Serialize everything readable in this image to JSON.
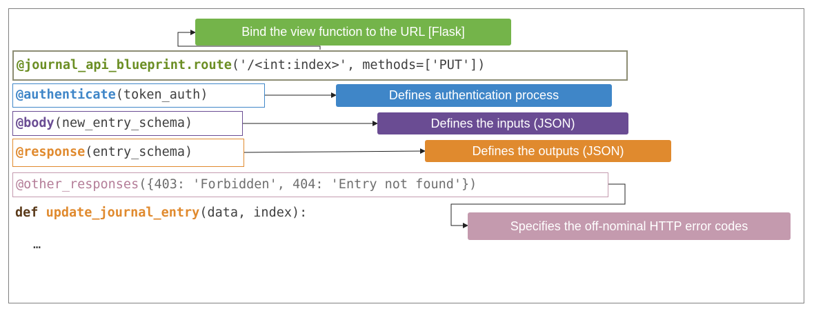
{
  "callouts": {
    "route": "Bind the view function to the URL [Flask]",
    "auth": "Defines authentication process",
    "inputs": "Defines the inputs (JSON)",
    "outputs": "Defines the outputs (JSON)",
    "errors": "Specifies the off-nominal HTTP error codes"
  },
  "code": {
    "line1_decorator": "@journal_api_blueprint.route",
    "line1_args": "('/<int:index>', methods=['PUT'])",
    "line2_decorator": "@authenticate",
    "line2_args": "(token_auth)",
    "line3_decorator": "@body",
    "line3_args": "(new_entry_schema)",
    "line4_decorator": "@response",
    "line4_args": "(entry_schema)",
    "line5_decorator": "@other_responses",
    "line5_args": "({403: 'Forbidden', 404: 'Entry not found'})",
    "line6_def": "def ",
    "line6_fn": "update_journal_entry",
    "line6_args": "(data, index):",
    "line7": "…"
  },
  "colors": {
    "route": "#74b44a",
    "auth": "#3f86c8",
    "inputs": "#6a4c93",
    "outputs": "#e08a2e",
    "errors": "#c49aae"
  }
}
